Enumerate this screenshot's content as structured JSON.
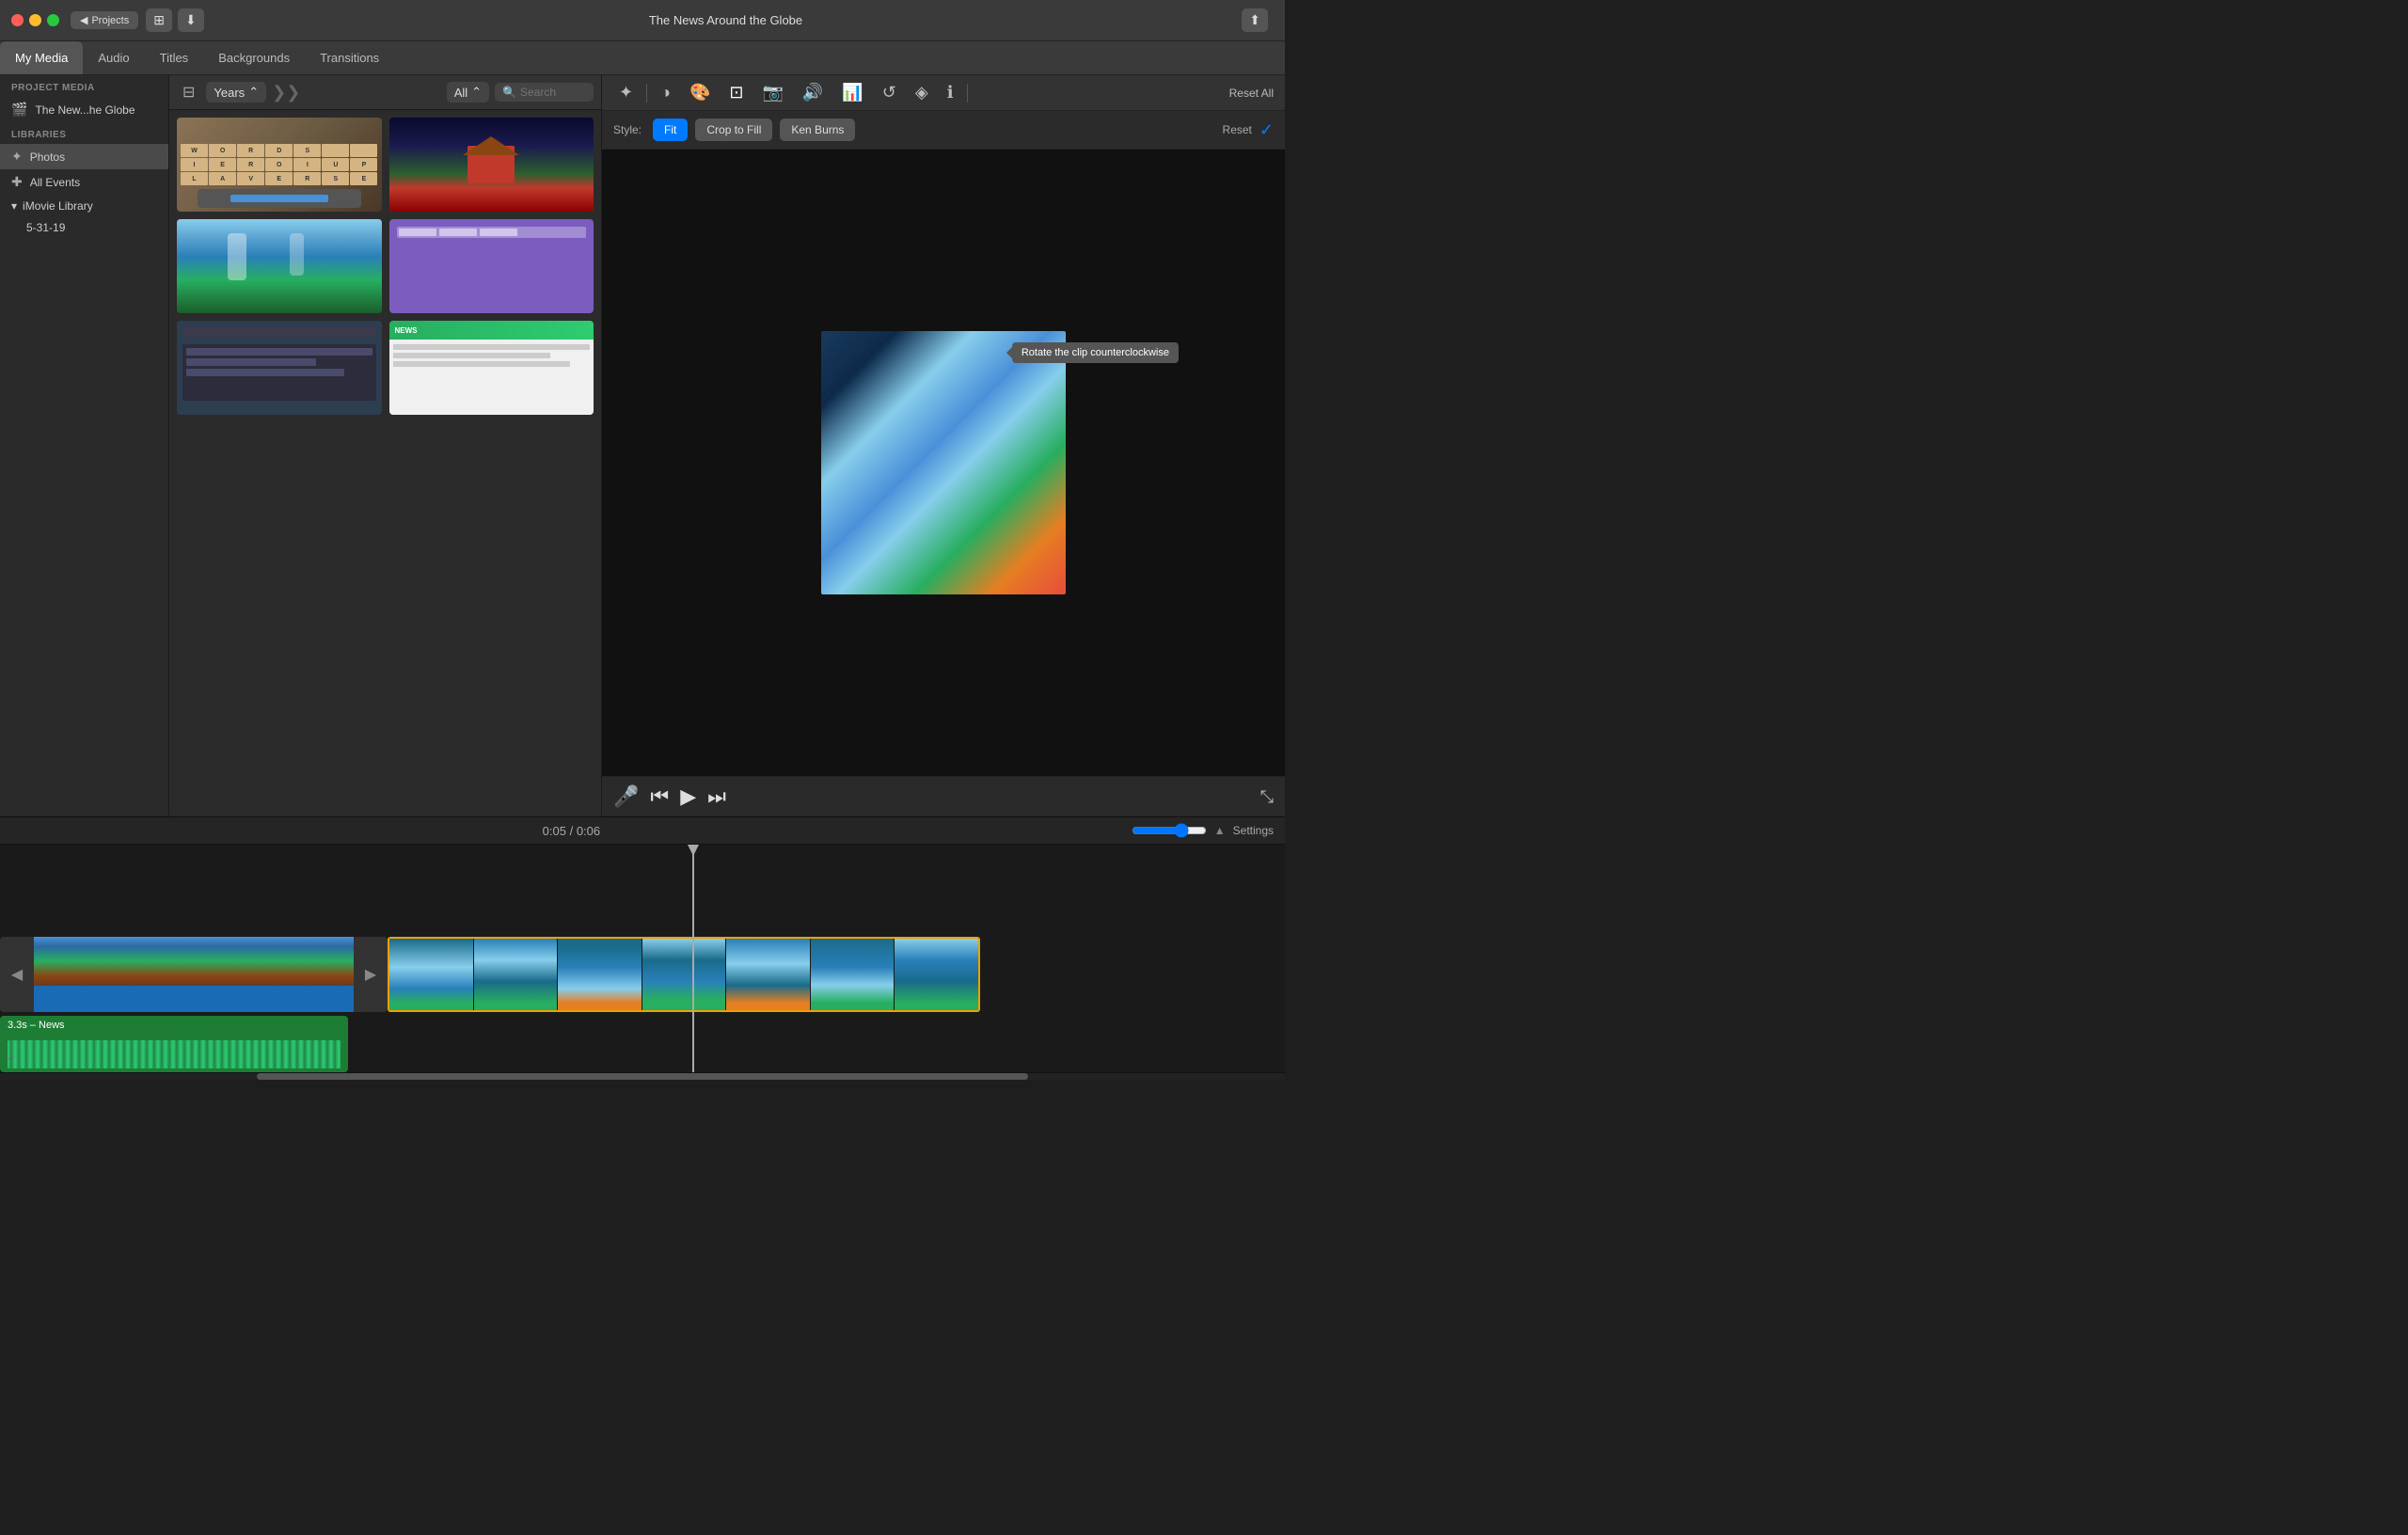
{
  "app": {
    "title": "The News Around the Globe"
  },
  "titlebar": {
    "back_label": "Projects",
    "reset_all_label": "Reset All"
  },
  "tabs": {
    "items": [
      {
        "label": "My Media",
        "active": true
      },
      {
        "label": "Audio",
        "active": false
      },
      {
        "label": "Titles",
        "active": false
      },
      {
        "label": "Backgrounds",
        "active": false
      },
      {
        "label": "Transitions",
        "active": false
      }
    ]
  },
  "sidebar": {
    "project_media_label": "PROJECT MEDIA",
    "project_name": "The New...he Globe",
    "libraries_label": "LIBRARIES",
    "photos_label": "Photos",
    "all_events_label": "All Events",
    "imovie_library_label": "iMovie Library",
    "date_label": "5-31-19"
  },
  "media_toolbar": {
    "years_label": "Years",
    "filter_label": "All",
    "search_placeholder": "Search"
  },
  "style_panel": {
    "style_label": "Style:",
    "fit_label": "Fit",
    "crop_to_fill_label": "Crop to Fill",
    "ken_burns_label": "Ken Burns",
    "reset_label": "Reset"
  },
  "tooltip": {
    "text": "Rotate the clip counterclockwise"
  },
  "playback": {
    "time_current": "0:05",
    "time_total": "0:06",
    "separator": "/"
  },
  "timeline": {
    "settings_label": "Settings",
    "audio_label": "3.3s – News"
  }
}
